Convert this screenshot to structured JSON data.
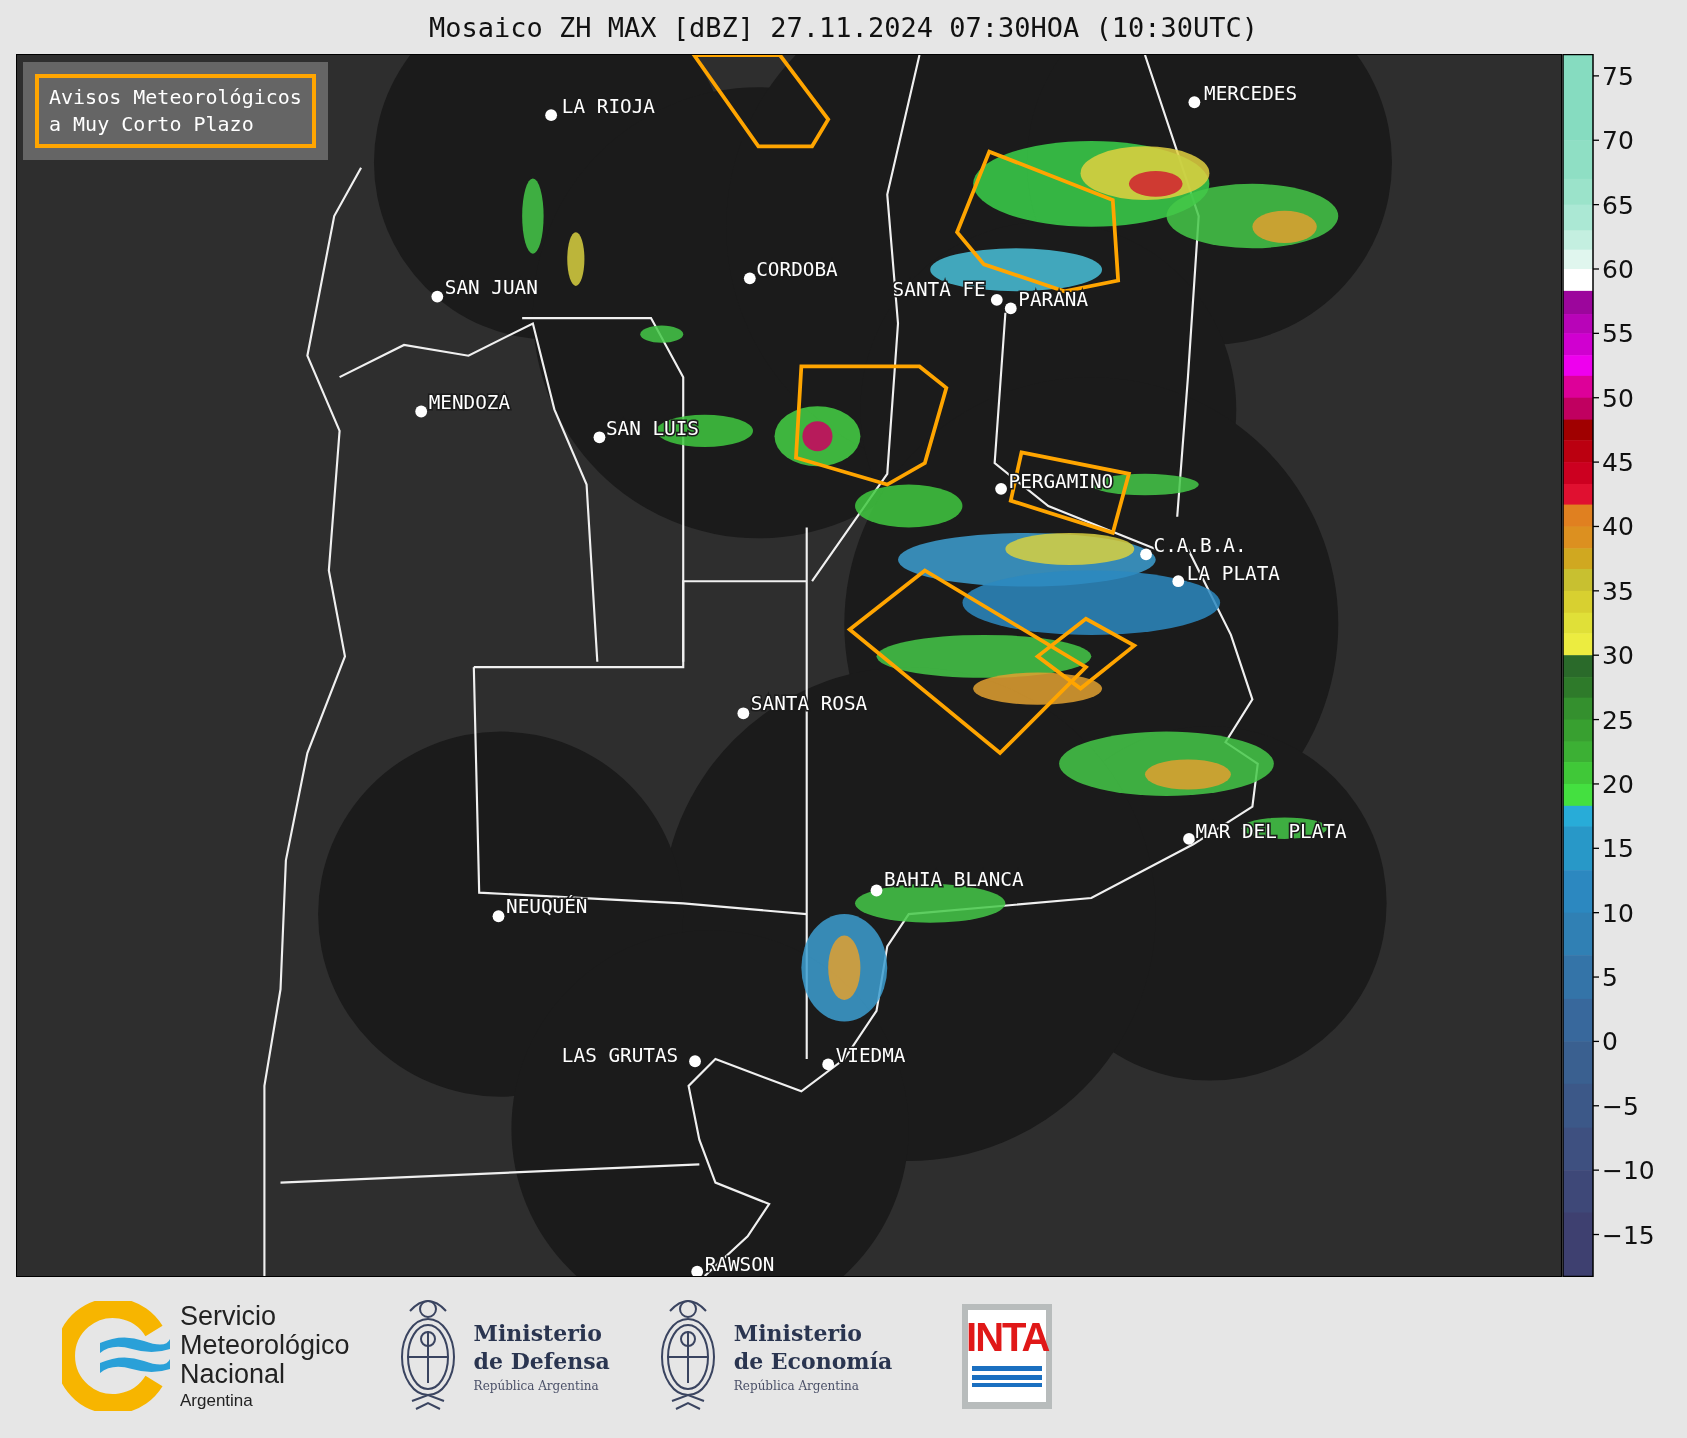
{
  "title": "Mosaico ZH MAX [dBZ] 27.11.2024 07:30HOA (10:30UTC)",
  "legend": {
    "lines": [
      "Avisos Meteorológicos",
      "a Muy Corto Plazo"
    ]
  },
  "cities": [
    {
      "name": "LA RIOJA"
    },
    {
      "name": "CORDOBA"
    },
    {
      "name": "SAN JUAN"
    },
    {
      "name": "SANTA FE"
    },
    {
      "name": "PARANA"
    },
    {
      "name": "MERCEDES"
    },
    {
      "name": "MENDOZA"
    },
    {
      "name": "SAN LUIS"
    },
    {
      "name": "PERGAMINO"
    },
    {
      "name": "C.A.B.A."
    },
    {
      "name": "LA PLATA"
    },
    {
      "name": "SANTA ROSA"
    },
    {
      "name": "MAR DEL PLATA"
    },
    {
      "name": "BAHIA BLANCA"
    },
    {
      "name": "NEUQUÉN"
    },
    {
      "name": "LAS GRUTAS"
    },
    {
      "name": "VIEDMA"
    },
    {
      "name": "RAWSON"
    }
  ],
  "colorbar": {
    "ticks": [
      "75",
      "70",
      "65",
      "60",
      "55",
      "50",
      "45",
      "40",
      "35",
      "30",
      "25",
      "20",
      "15",
      "10",
      "5",
      "0",
      "−5",
      "−10",
      "−15"
    ]
  },
  "footer": {
    "smn": [
      "Servicio",
      "Meteorológico",
      "Nacional",
      "Argentina"
    ],
    "defensa": [
      "Ministerio",
      "de Defensa",
      "República Argentina"
    ],
    "economia": [
      "Ministerio",
      "de Economía",
      "República Argentina"
    ],
    "inta": "INTA"
  }
}
